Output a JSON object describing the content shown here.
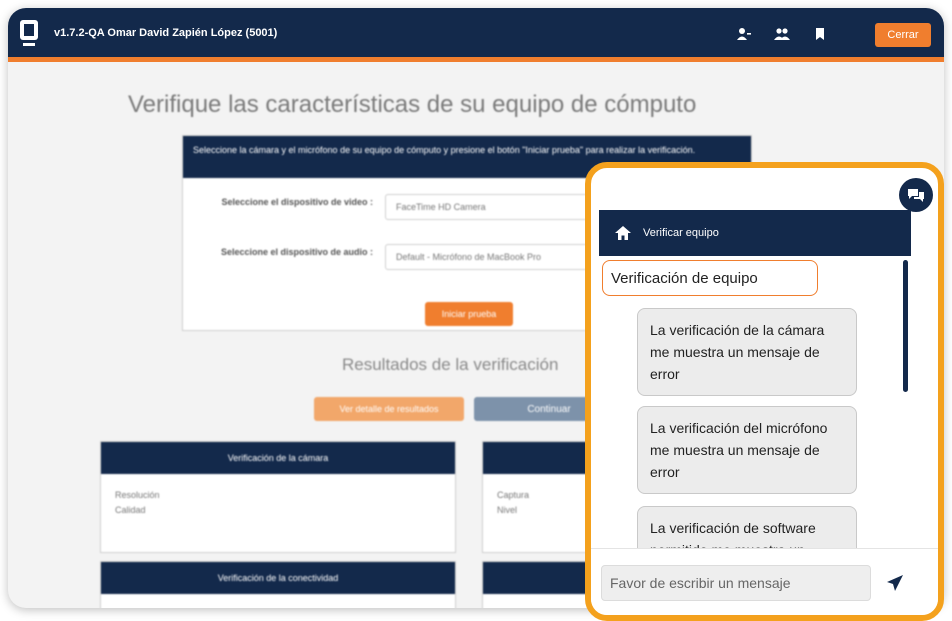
{
  "header": {
    "version_user": "v1.7.2-QA  Omar David Zapién López (5001)",
    "close_label": "Cerrar"
  },
  "main": {
    "title": "Verifique las características de su equipo de cómputo",
    "card": {
      "instructions": "Seleccione la cámara y el micrófono de su equipo de cómputo y presione el botón \"Iniciar prueba\" para realizar la verificación.",
      "video_label": "Seleccione el dispositivo de video :",
      "video_value": "FaceTime HD Camera",
      "audio_label": "Seleccione el dispositivo de audio :",
      "audio_value": "Default - Micrófono de MacBook Pro",
      "start_button": "Iniciar prueba"
    },
    "results_title": "Resultados de la verificación",
    "details_button": "Ver detalle de resultados",
    "continue_button": "Continuar",
    "panels": {
      "camera": {
        "title": "Verificación de la cámara",
        "line1": "Resolución",
        "line2": "Calidad"
      },
      "audio": {
        "line1": "Captura",
        "line2": "Nivel"
      },
      "connectivity": {
        "title": "Verificación de la conectividad"
      }
    }
  },
  "chat": {
    "header_label": "Verificar equipo",
    "selected_option": "Verificación de equipo",
    "options": [
      "La verificación de la cámara me muestra un mensaje de error",
      "La verificación del micrófono me muestra un mensaje de error",
      "La verificación de software permitido me muestra un"
    ],
    "input_placeholder": "Favor de escribir un mensaje"
  },
  "colors": {
    "navy": "#13294b",
    "orange": "#f07e2e",
    "highlight_border": "#f4a11d"
  }
}
